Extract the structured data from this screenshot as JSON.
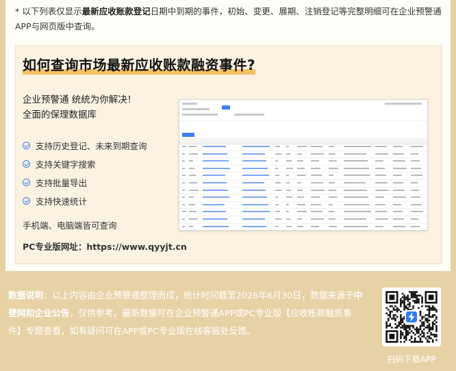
{
  "note": {
    "prefix": "* 以下列表仅显示",
    "bold": "最新应收账款登记",
    "suffix": "日期中到期的事件，初始、变更、展期、注销登记等完整明细可在企业预警通APP与网页版中查询。"
  },
  "promo": {
    "title": "如何查询市场最新应收账款融资事件?",
    "slogan_line1": "企业预警通 统统为你解决！",
    "slogan_line2": "全面的保理数据库",
    "features": [
      "支持历史登记、未来到期查询",
      "支持关键字搜索",
      "支持批量导出",
      "支持快速统计"
    ],
    "devices": "手机端、电脑端皆可查询",
    "pc_url": "PC专业版网址：https://www.qyyjt.cn"
  },
  "footer": {
    "label": "数据说明",
    "part1": "：以上内容由企业预警通整理而成，统计时间截至2026年6月30日，数据来源于",
    "sources": "中登网和企业公告",
    "part2": "，仅供参考。最新数据可在企业预警通APP或PC专业版【应收账款融资事件】专题查看，如有疑问可在APP或PC专业版在线客服处反馈。"
  },
  "qr": {
    "caption": "扫码下载APP",
    "icon": "lightning-bolt-icon",
    "accent": "#2f7cf6"
  },
  "colors": {
    "background": "#e7d2a6",
    "highlight": "#f3c064",
    "check": "#3d7ff0"
  }
}
